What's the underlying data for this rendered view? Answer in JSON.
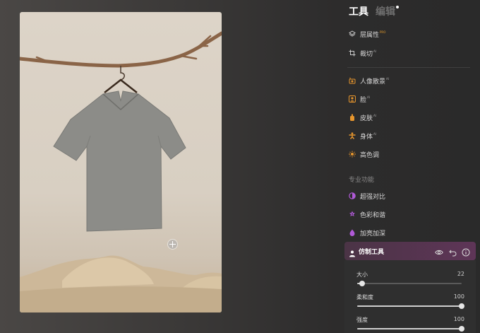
{
  "tabs": {
    "tools_label": "工具",
    "edit_label": "编辑"
  },
  "tools": [
    {
      "label": "层属性",
      "sup": "PRO",
      "icon": "layers-icon"
    },
    {
      "label": "裁切",
      "sup": "AI",
      "icon": "crop-icon"
    },
    {
      "label": "人像散景",
      "sup": "AI",
      "icon": "portrait-bokeh-icon"
    },
    {
      "label": "脸",
      "sup": "AI",
      "icon": "face-icon"
    },
    {
      "label": "皮肤",
      "sup": "AI",
      "icon": "skin-icon"
    },
    {
      "label": "身体",
      "sup": "AI",
      "icon": "body-icon"
    },
    {
      "label": "高色调",
      "sup": "",
      "icon": "high-tone-icon"
    }
  ],
  "pro_section": {
    "title": "专业功能"
  },
  "pro_tools": [
    {
      "label": "超强对比",
      "icon": "contrast-icon"
    },
    {
      "label": "色彩和谐",
      "icon": "color-harmony-icon"
    },
    {
      "label": "加亮加深",
      "icon": "dodge-burn-icon"
    }
  ],
  "clone_tool": {
    "title": "仿制工具",
    "icon": "clone-stamp-icon"
  },
  "sliders": [
    {
      "label": "大小",
      "value": "22",
      "fraction": 0.05
    },
    {
      "label": "柔和度",
      "value": "100",
      "fraction": 1.0
    },
    {
      "label": "强度",
      "value": "100",
      "fraction": 1.0
    }
  ],
  "colors": {
    "accent_orange": "#e7962d",
    "accent_purple": "#b05ad8",
    "card_purple": "#5e3557"
  }
}
